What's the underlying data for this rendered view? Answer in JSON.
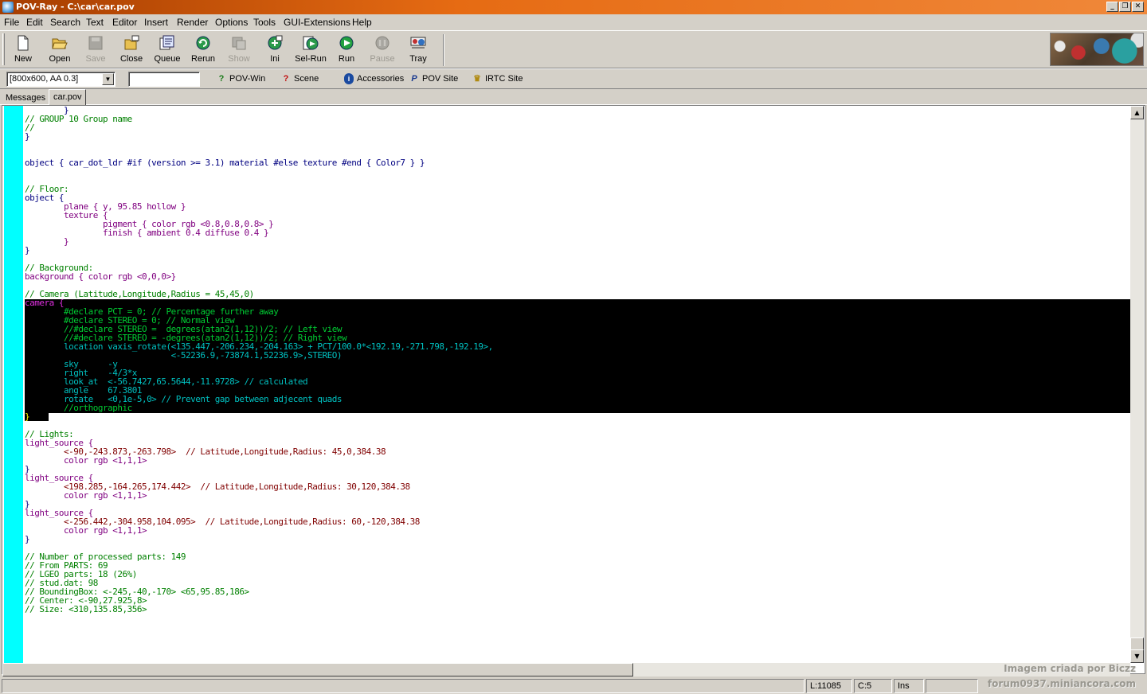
{
  "window": {
    "title": "POV-Ray - C:\\car\\car.pov"
  },
  "menu": [
    "File",
    "Edit",
    "Search",
    "Text",
    "Editor",
    "Insert",
    "Render",
    "Options",
    "Tools",
    "GUI-Extensions",
    "Help"
  ],
  "toolbar": {
    "new": "New",
    "open": "Open",
    "save": "Save",
    "close": "Close",
    "queue": "Queue",
    "rerun": "Rerun",
    "show": "Show",
    "ini": "Ini",
    "selrun": "Sel-Run",
    "run": "Run",
    "pause": "Pause",
    "tray": "Tray"
  },
  "toolbar2": {
    "resolution": "[800x600, AA 0.3]",
    "input_value": "",
    "povwin": "POV-Win",
    "scene": "Scene",
    "accessories": "Accessories",
    "povsite": "POV Site",
    "irtcsite": "IRTC Site"
  },
  "tabs": [
    "Messages",
    "car.pov"
  ],
  "code": {
    "l0": "        }",
    "l1": "// GROUP 10 Group name",
    "l2": "//",
    "l3": "}",
    "l6": "object { car_dot_ldr #if (version >= 3.1) material #else texture #end { Color7 } }",
    "l9": "// Floor:",
    "l10": "object {",
    "l11": "        plane { y, 95.85 hollow }",
    "l12": "        texture {",
    "l13": "                pigment { color rgb <0.8,0.8,0.8> }",
    "l14": "                finish { ambient 0.4 diffuse 0.4 }",
    "l15": "        }",
    "l16": "}",
    "l18": "// Background:",
    "l19": "background { color rgb <0,0,0>}",
    "l21": "// Camera (Latitude,Longitude,Radius = 45,45,0)",
    "l22": "camera {",
    "l23": "        #declare PCT = 0; // Percentage further away",
    "l24": "        #declare STEREO = 0; // Normal view",
    "l25": "        //#declare STEREO =  degrees(atan2(1,12))/2; // Left view",
    "l26": "        //#declare STEREO = -degrees(atan2(1,12))/2; // Right view",
    "l27": "        location vaxis_rotate(<135.447,-206.234,-204.163> + PCT/100.0*<192.19,-271.798,-192.19>,",
    "l28": "                              <-52236.9,-73874.1,52236.9>,STEREO)",
    "l29": "        sky      -y",
    "l30": "        right    -4/3*x",
    "l31": "        look_at  <-56.7427,65.5644,-11.9728> // calculated",
    "l32": "        angle    67.3801",
    "l33": "        rotate   <0,1e-5,0> // Prevent gap between adjecent quads",
    "l34": "        //orthographic",
    "l35": "}",
    "l37": "// Lights:",
    "l38": "light_source {",
    "l39": "        <-90,-243.873,-263.798>  // Latitude,Longitude,Radius: 45,0,384.38",
    "l40": "        color rgb <1,1,1>",
    "l41": "}",
    "l42": "light_source {",
    "l43": "        <198.285,-164.265,174.442>  // Latitude,Longitude,Radius: 30,120,384.38",
    "l44": "        color rgb <1,1,1>",
    "l45": "}",
    "l46": "light_source {",
    "l47": "        <-256.442,-304.958,104.095>  // Latitude,Longitude,Radius: 60,-120,384.38",
    "l48": "        color rgb <1,1,1>",
    "l49": "}",
    "l51": "// Number of processed parts: 149",
    "l52": "// From PARTS: 69",
    "l53": "// LGEO parts: 18 (26%)",
    "l54": "// stud.dat: 98",
    "l55": "// BoundingBox: <-245,-40,-170> <65,95.85,186>",
    "l56": "// Center: <-90,27.925,8>",
    "l57": "// Size: <310,135.85,356>"
  },
  "status": {
    "line": "L:11085",
    "col": "C:5",
    "mode": "Ins"
  },
  "watermark": {
    "line1": "Imagem criada por Biczz",
    "line2": "forum0937.miniancora.com"
  }
}
